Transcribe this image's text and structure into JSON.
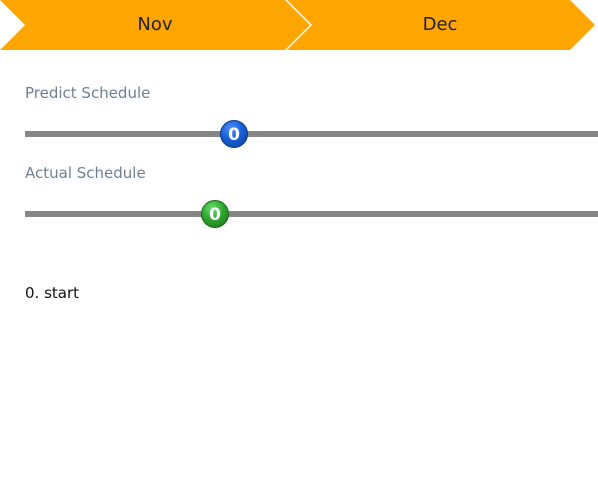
{
  "timeline": {
    "months": [
      "Nov",
      "Dec"
    ],
    "color": "#FFA500"
  },
  "predict_schedule": {
    "label": "Predict Schedule",
    "value": "0",
    "knob_color": "#1a5fd6"
  },
  "actual_schedule": {
    "label": "Actual Schedule",
    "value": "0",
    "knob_color": "#2ea62e"
  },
  "status": {
    "text": "0. start"
  }
}
